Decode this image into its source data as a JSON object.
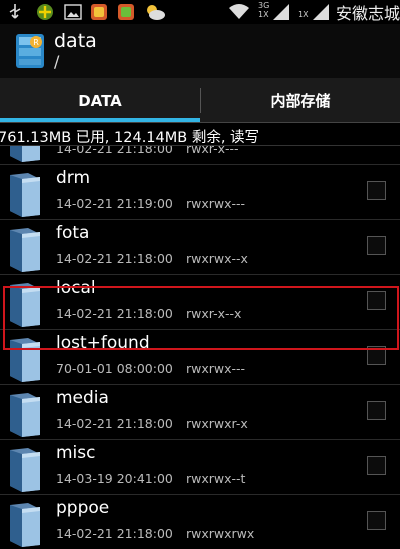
{
  "status_bar": {
    "signal_1": "3G\n1X",
    "signal_2": "1X",
    "carrier": "安徽志城"
  },
  "header": {
    "title": "data",
    "path": "/"
  },
  "tabs": [
    {
      "label": "DATA",
      "active": true
    },
    {
      "label": "内部存储",
      "active": false
    }
  ],
  "storage_info": "761.13MB 已用, 124.14MB 剩余, 读写",
  "files": [
    {
      "name": "",
      "date": "14-02-21 21:18:00",
      "perm": "rwxr-x---",
      "checked": false
    },
    {
      "name": "drm",
      "date": "14-02-21 21:19:00",
      "perm": "rwxrwx---",
      "checked": false
    },
    {
      "name": "fota",
      "date": "14-02-21 21:18:00",
      "perm": "rwxrwx--x",
      "checked": false
    },
    {
      "name": "local",
      "date": "14-02-21 21:18:00",
      "perm": "rwxr-x--x",
      "checked": false
    },
    {
      "name": "lost+found",
      "date": "70-01-01 08:00:00",
      "perm": "rwxrwx---",
      "checked": false
    },
    {
      "name": "media",
      "date": "14-02-21 21:18:00",
      "perm": "rwxrwxr-x",
      "checked": false
    },
    {
      "name": "misc",
      "date": "14-03-19 20:41:00",
      "perm": "rwxrwx--t",
      "checked": false
    },
    {
      "name": "pppoe",
      "date": "14-02-21 21:18:00",
      "perm": "rwxrwxrwx",
      "checked": false
    }
  ],
  "colors": {
    "accent": "#33b5e5",
    "highlight": "#d0161c"
  }
}
